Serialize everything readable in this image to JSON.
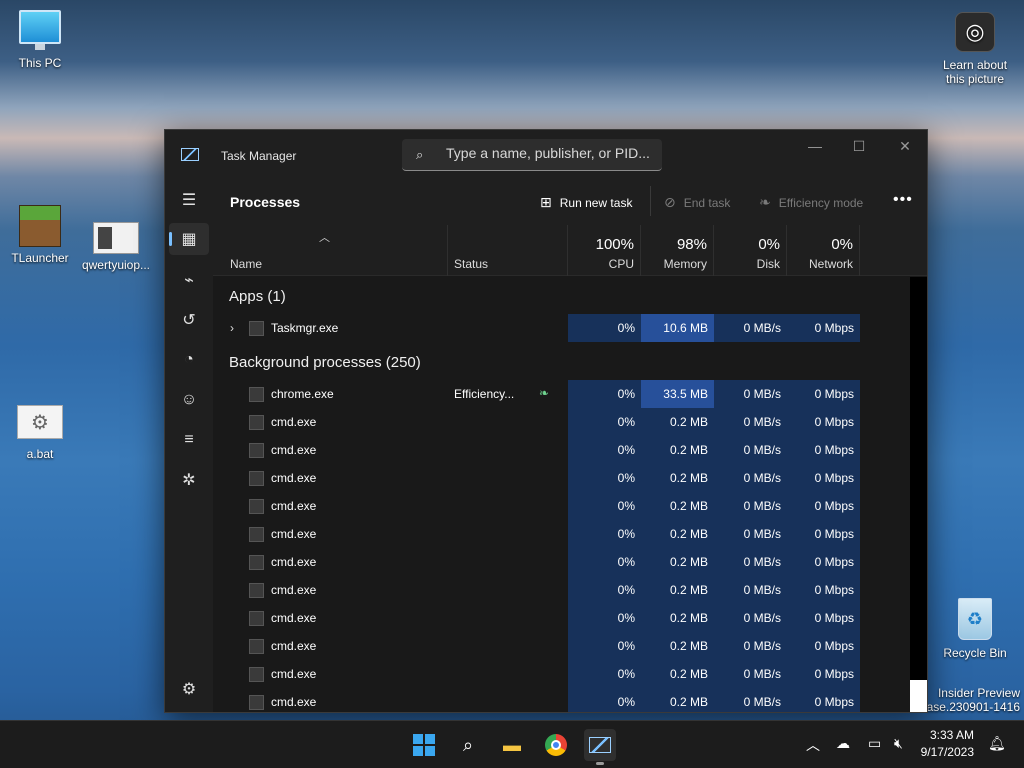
{
  "desktop": {
    "icons": [
      {
        "label": "This PC"
      },
      {
        "label": "TLauncher"
      },
      {
        "label": "qwertyuiop..."
      },
      {
        "label": "a.bat"
      },
      {
        "label": "Recycle Bin"
      }
    ],
    "learn": {
      "line1": "Learn about",
      "line2": "this picture"
    },
    "watermark": {
      "line1": "Insider Preview",
      "line2": "ase.230901-1416"
    }
  },
  "window": {
    "title": "Task Manager",
    "search_placeholder": "Type a name, publisher, or PID...",
    "controls": {
      "minimize": "—",
      "maximize": "☐",
      "close": "✕"
    }
  },
  "toolbar": {
    "page_title": "Processes",
    "run_new_task": "Run new task",
    "end_task": "End task",
    "efficiency_mode": "Efficiency mode",
    "more": "•••"
  },
  "columns": {
    "name": "Name",
    "status": "Status",
    "cpu": {
      "pct": "100%",
      "label": "CPU"
    },
    "memory": {
      "pct": "98%",
      "label": "Memory"
    },
    "disk": {
      "pct": "0%",
      "label": "Disk"
    },
    "network": {
      "pct": "0%",
      "label": "Network"
    }
  },
  "groups": {
    "apps": "Apps (1)",
    "background": "Background processes (250)"
  },
  "apps": [
    {
      "name": "Taskmgr.exe",
      "status": "",
      "cpu": "0%",
      "memory": "10.6 MB",
      "disk": "0 MB/s",
      "network": "0 Mbps"
    }
  ],
  "background": [
    {
      "name": "chrome.exe",
      "status": "Efficiency...",
      "cpu": "0%",
      "memory": "33.5 MB",
      "disk": "0 MB/s",
      "network": "0 Mbps"
    },
    {
      "name": "cmd.exe",
      "status": "",
      "cpu": "0%",
      "memory": "0.2 MB",
      "disk": "0 MB/s",
      "network": "0 Mbps"
    },
    {
      "name": "cmd.exe",
      "status": "",
      "cpu": "0%",
      "memory": "0.2 MB",
      "disk": "0 MB/s",
      "network": "0 Mbps"
    },
    {
      "name": "cmd.exe",
      "status": "",
      "cpu": "0%",
      "memory": "0.2 MB",
      "disk": "0 MB/s",
      "network": "0 Mbps"
    },
    {
      "name": "cmd.exe",
      "status": "",
      "cpu": "0%",
      "memory": "0.2 MB",
      "disk": "0 MB/s",
      "network": "0 Mbps"
    },
    {
      "name": "cmd.exe",
      "status": "",
      "cpu": "0%",
      "memory": "0.2 MB",
      "disk": "0 MB/s",
      "network": "0 Mbps"
    },
    {
      "name": "cmd.exe",
      "status": "",
      "cpu": "0%",
      "memory": "0.2 MB",
      "disk": "0 MB/s",
      "network": "0 Mbps"
    },
    {
      "name": "cmd.exe",
      "status": "",
      "cpu": "0%",
      "memory": "0.2 MB",
      "disk": "0 MB/s",
      "network": "0 Mbps"
    },
    {
      "name": "cmd.exe",
      "status": "",
      "cpu": "0%",
      "memory": "0.2 MB",
      "disk": "0 MB/s",
      "network": "0 Mbps"
    },
    {
      "name": "cmd.exe",
      "status": "",
      "cpu": "0%",
      "memory": "0.2 MB",
      "disk": "0 MB/s",
      "network": "0 Mbps"
    },
    {
      "name": "cmd.exe",
      "status": "",
      "cpu": "0%",
      "memory": "0.2 MB",
      "disk": "0 MB/s",
      "network": "0 Mbps"
    },
    {
      "name": "cmd.exe",
      "status": "",
      "cpu": "0%",
      "memory": "0.2 MB",
      "disk": "0 MB/s",
      "network": "0 Mbps"
    }
  ],
  "taskbar": {
    "time": "3:33 AM",
    "date": "9/17/2023"
  },
  "colors": {
    "accent": "#7ac0ff",
    "heat_low": "#17315a",
    "heat_high": "#27509a",
    "efficiency_leaf": "#6fd38f"
  }
}
